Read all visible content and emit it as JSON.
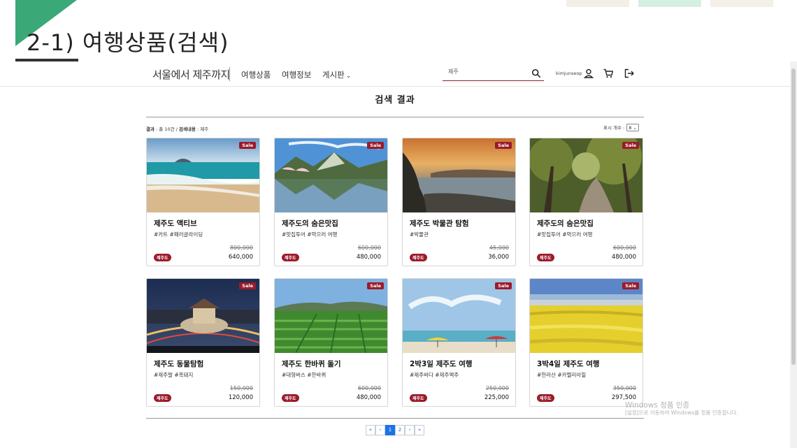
{
  "slide": {
    "title": "2-1) 여행상품(검색)",
    "accent_color": "#3aa877"
  },
  "header": {
    "logo_text": "서울에서 제주까지",
    "nav": [
      {
        "label": "여행상품"
      },
      {
        "label": "여행정보"
      },
      {
        "label": "게시판"
      }
    ],
    "search": {
      "value": "제주",
      "icon": "search-icon"
    },
    "username": "kimjunseop",
    "icons": [
      "user-icon",
      "cart-icon",
      "logout-icon"
    ]
  },
  "main": {
    "title": "검색 결과",
    "summary": {
      "result_label": "결과",
      "result_value": "총 10건",
      "separator": "/",
      "keyword_label": "검색내용",
      "keyword_value": "제주"
    },
    "per_page": {
      "label": "표시 개수 :",
      "value": "8"
    }
  },
  "colors": {
    "brand": "#9b1b2a",
    "pagination_active": "#1a73e8"
  },
  "products": [
    {
      "title": "제주도 액티브",
      "tags": "#카트 #패러글라이딩",
      "old_price": "800,000",
      "price": "640,000",
      "sale": "Sale",
      "region": "제주도",
      "image": "beach-sea-image"
    },
    {
      "title": "제주도의 숨은맛집",
      "tags": "#맛집투어 #먹으러 여행",
      "old_price": "600,000",
      "price": "480,000",
      "sale": "Sale",
      "region": "제주도",
      "image": "lake-mountain-image"
    },
    {
      "title": "제주도 박물관 탐험",
      "tags": "#박물관",
      "old_price": "45,000",
      "price": "36,000",
      "sale": "Sale",
      "region": "제주도",
      "image": "sunset-coast-image"
    },
    {
      "title": "제주도의 숨은맛집",
      "tags": "#맛집투어 #먹으러 여행",
      "old_price": "600,000",
      "price": "480,000",
      "sale": "Sale",
      "region": "제주도",
      "image": "forest-road-image"
    },
    {
      "title": "제주도 동물탐험",
      "tags": "#제주말 #흑돼지",
      "old_price": "150,000",
      "price": "120,000",
      "sale": "Sale",
      "region": "제주도",
      "image": "night-gate-image"
    },
    {
      "title": "제주도 한바퀴 돌기",
      "tags": "#대형버스 #한바퀴",
      "old_price": "600,000",
      "price": "480,000",
      "sale": "Sale",
      "region": "제주도",
      "image": "green-tea-field-image"
    },
    {
      "title": "2박3일 제주도 여행",
      "tags": "#제주바다 #제주맥주",
      "old_price": "250,000",
      "price": "225,000",
      "sale": "Sale",
      "region": "제주도",
      "image": "beach-umbrella-image"
    },
    {
      "title": "3박4일 제주도 여행",
      "tags": "#한라산 #카멜리아힐",
      "old_price": "350,000",
      "price": "297,500",
      "sale": "Sale",
      "region": "제주도",
      "image": "canola-field-image"
    }
  ],
  "pagination": {
    "first": "«",
    "prev": "‹",
    "pages": [
      "1",
      "2"
    ],
    "active": "1",
    "next": "›",
    "last": "»"
  },
  "watermark": {
    "line1": "Windows 정품 인증",
    "line2": "[설정]으로 이동하여 Windows를 정품 인증합니다."
  }
}
